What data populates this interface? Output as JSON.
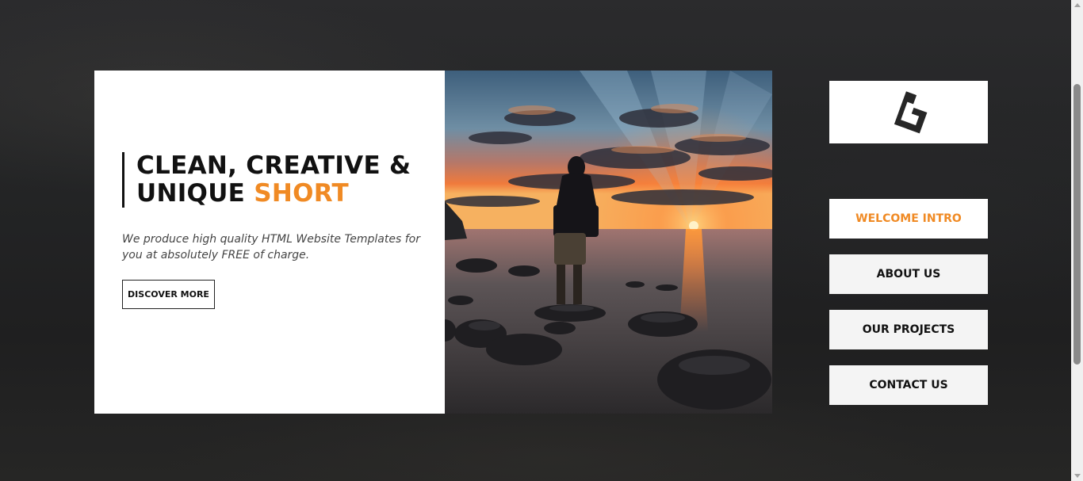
{
  "hero": {
    "title_line1": "CLEAN, CREATIVE &",
    "title_line2_prefix": "UNIQUE ",
    "title_line2_accent": "SHORT",
    "description": "We produce high quality HTML Website Templates for you at absolutely FREE of charge.",
    "button_label": "DISCOVER MORE",
    "photo_icon": "sunset-man-on-rocks-photo"
  },
  "logo": {
    "icon": "brand-logo-icon"
  },
  "nav": {
    "items": [
      {
        "label": "WELCOME INTRO",
        "active": true
      },
      {
        "label": "ABOUT US",
        "active": false
      },
      {
        "label": "OUR PROJECTS",
        "active": false
      },
      {
        "label": "CONTACT US",
        "active": false
      }
    ]
  },
  "colors": {
    "accent": "#f08a24",
    "text": "#111111",
    "background": "#222223",
    "nav_background": "#f4f4f4"
  }
}
